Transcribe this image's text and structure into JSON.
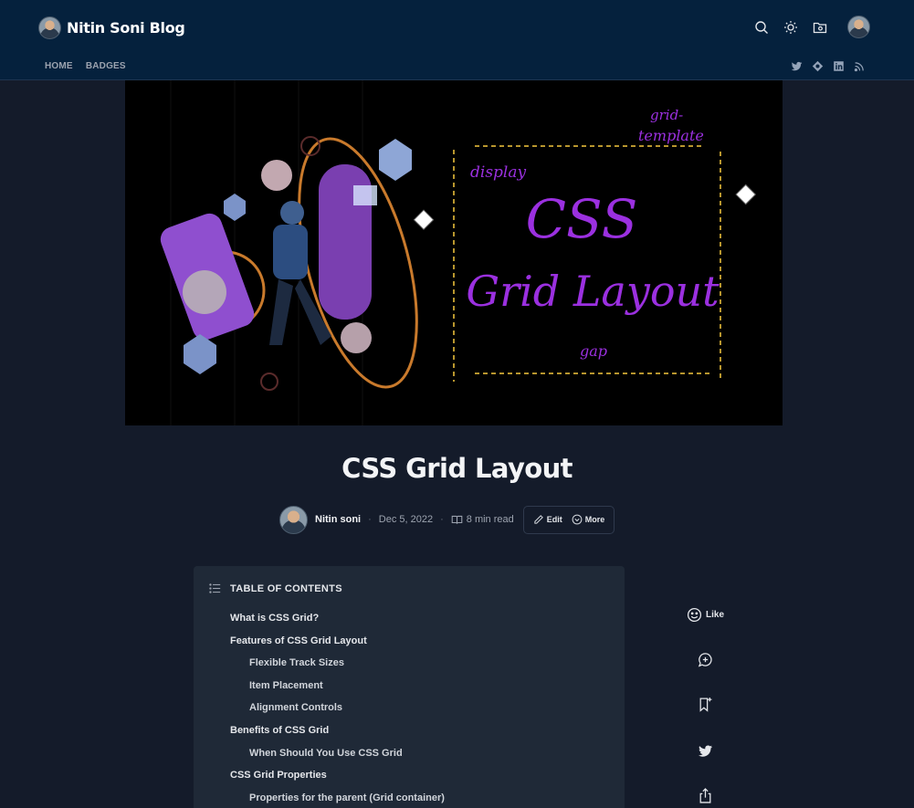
{
  "header": {
    "blog_title": "Nitin Soni Blog",
    "nav": [
      "HOME",
      "BADGES"
    ],
    "icons": [
      "search-icon",
      "sun-icon",
      "folder-icon",
      "avatar"
    ],
    "social_icons": [
      "twitter-icon",
      "hashnode-icon",
      "linkedin-icon",
      "rss-icon"
    ],
    "colors": {
      "header_bg": "#05213d",
      "page_bg": "#141b2a"
    }
  },
  "cover": {
    "headline_line1": "CSS",
    "headline_line2": "Grid Layout",
    "words": {
      "display": "display",
      "grid_template_1": "grid-",
      "grid_template_2": "template",
      "gap": "gap"
    },
    "colors": {
      "accent_purple": "#9b30e0",
      "frame_gold": "#b8962e"
    }
  },
  "post": {
    "title": "CSS Grid Layout",
    "author": "Nitin soni",
    "date": "Dec 5, 2022",
    "read_time": "8 min read",
    "edit_label": "Edit",
    "more_label": "More"
  },
  "toc": {
    "heading": "TABLE OF CONTENTS",
    "items": [
      {
        "label": "What is CSS Grid?",
        "level": 1
      },
      {
        "label": "Features of CSS Grid Layout",
        "level": 1
      },
      {
        "label": "Flexible Track Sizes",
        "level": 2
      },
      {
        "label": "Item Placement",
        "level": 2
      },
      {
        "label": "Alignment Controls",
        "level": 2
      },
      {
        "label": "Benefits of CSS Grid",
        "level": 1
      },
      {
        "label": "When Should You Use CSS Grid",
        "level": 2
      },
      {
        "label": "CSS Grid Properties",
        "level": 1
      },
      {
        "label": "Properties for the parent (Grid container)",
        "level": 2
      }
    ]
  },
  "floating": {
    "like_label": "Like",
    "icons": [
      "like-icon",
      "comment-icon",
      "bookmark-icon",
      "twitter-icon",
      "share-icon"
    ]
  }
}
